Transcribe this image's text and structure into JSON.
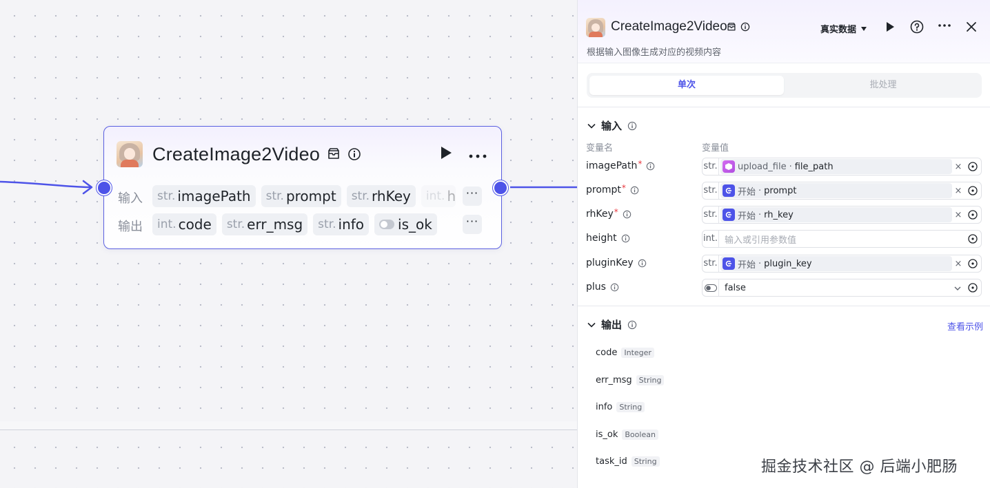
{
  "node": {
    "title": "CreateImage2Video",
    "input_label": "输入",
    "output_label": "输出",
    "inputs": [
      {
        "type": "str.",
        "name": "imagePath"
      },
      {
        "type": "str.",
        "name": "prompt"
      },
      {
        "type": "str.",
        "name": "rhKey"
      },
      {
        "type": "int.",
        "name": "h"
      }
    ],
    "outputs": [
      {
        "type": "int.",
        "name": "code"
      },
      {
        "type": "str.",
        "name": "err_msg"
      },
      {
        "type": "str.",
        "name": "info"
      },
      {
        "type": "toggle",
        "name": "is_ok"
      }
    ],
    "more_label": "···"
  },
  "panel": {
    "title": "CreateImage2Video",
    "description": "根据输入图像生成对应的视频内容",
    "mode_label": "真实数据",
    "tabs": [
      {
        "label": "单次",
        "active": true
      },
      {
        "label": "批处理",
        "active": false
      }
    ],
    "input_section": {
      "title": "输入",
      "col_name": "变量名",
      "col_value": "变量值",
      "rows": [
        {
          "name": "imagePath",
          "required": true,
          "type": "str.",
          "kind": "ref",
          "ref_icon": "plugin",
          "source": "upload_file",
          "field": "file_path"
        },
        {
          "name": "prompt",
          "required": true,
          "type": "str.",
          "kind": "ref",
          "ref_icon": "start",
          "source": "开始",
          "field": "prompt"
        },
        {
          "name": "rhKey",
          "required": true,
          "type": "str.",
          "kind": "ref",
          "ref_icon": "start",
          "source": "开始",
          "field": "rh_key"
        },
        {
          "name": "height",
          "required": false,
          "type": "int.",
          "kind": "input",
          "placeholder": "输入或引用参数值"
        },
        {
          "name": "pluginKey",
          "required": false,
          "type": "str.",
          "kind": "ref",
          "ref_icon": "start",
          "source": "开始",
          "field": "plugin_key"
        },
        {
          "name": "plus",
          "required": false,
          "type": "toggle",
          "kind": "select",
          "value": "false"
        }
      ]
    },
    "output_section": {
      "title": "输出",
      "example_link": "查看示例",
      "rows": [
        {
          "name": "code",
          "type": "Integer"
        },
        {
          "name": "err_msg",
          "type": "String"
        },
        {
          "name": "info",
          "type": "String"
        },
        {
          "name": "is_ok",
          "type": "Boolean"
        },
        {
          "name": "task_id",
          "type": "String"
        }
      ]
    }
  },
  "watermark": "掘金技术社区 @ 后端小肥肠",
  "colors": {
    "accent": "#4d53e8",
    "required": "#e8373e",
    "plugin_icon": "#c65ee8"
  }
}
